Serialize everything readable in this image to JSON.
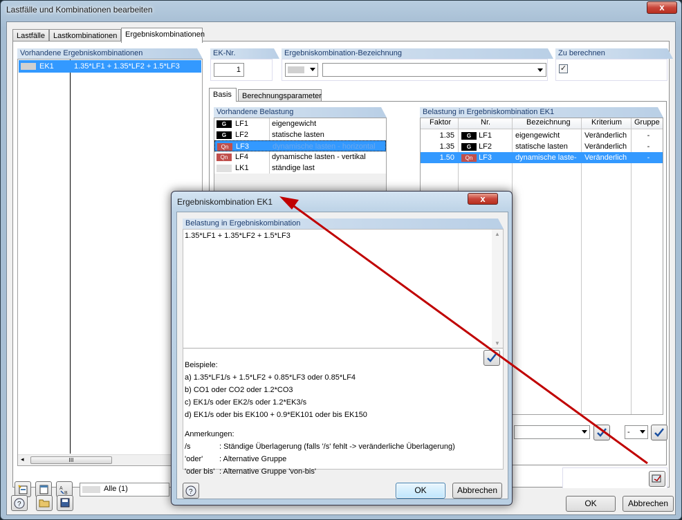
{
  "window": {
    "title": "Lastfälle und Kombinationen bearbeiten",
    "close": "x"
  },
  "tabs": [
    "Lastfälle",
    "Lastkombinationen",
    "Ergebniskombinationen"
  ],
  "left": {
    "header": "Vorhandene Ergebniskombinationen",
    "items": [
      {
        "id": "EK1",
        "formula": "1.35*LF1 + 1.35*LF2 + 1.5*LF3"
      }
    ],
    "scroll_thumb": "III",
    "filter": "Alle (1)"
  },
  "ek": {
    "label": "EK-Nr.",
    "value": "1"
  },
  "bez": {
    "label": "Ergebniskombination-Bezeichnung",
    "value": ""
  },
  "zu": {
    "label": "Zu berechnen",
    "checked": "✓"
  },
  "subtabs": [
    "Basis",
    "Berechnungsparameter"
  ],
  "vb": {
    "header": "Vorhandene Belastung",
    "rows": [
      {
        "type": "G",
        "id": "LF1",
        "name": "eigengewicht"
      },
      {
        "type": "G",
        "id": "LF2",
        "name": "statische lasten"
      },
      {
        "type": "Qn",
        "id": "LF3",
        "name": "dynamische lasten - horizontal"
      },
      {
        "type": "Qn",
        "id": "LF4",
        "name": "dynamische lasten - vertikal"
      },
      {
        "type": "",
        "id": "LK1",
        "name": "ständige last"
      }
    ]
  },
  "bek": {
    "header": "Belastung in Ergebniskombination EK1",
    "cols": [
      "Faktor",
      "Nr.",
      "Bezeichnung",
      "Kriterium",
      "Gruppe"
    ],
    "rows": [
      {
        "f": "1.35",
        "type": "G",
        "id": "LF1",
        "name": "eigengewicht",
        "k": "Veränderlich",
        "g": "-"
      },
      {
        "f": "1.35",
        "type": "G",
        "id": "LF2",
        "name": "statische lasten",
        "k": "Veränderlich",
        "g": "-"
      },
      {
        "f": "1.50",
        "type": "Qn",
        "id": "LF3",
        "name": "dynamische laste-",
        "k": "Veränderlich",
        "g": "-"
      }
    ],
    "gruppe_sel": "-"
  },
  "dialog": {
    "title": "Ergebniskombination EK1",
    "close": "x",
    "header": "Belastung in Ergebniskombination",
    "formula": "1.35*LF1 + 1.35*LF2 + 1.5*LF3",
    "beispiele_label": "Beispiele:",
    "beispiele": [
      "a)  1.35*LF1/s + 1.5*LF2 + 0.85*LF3 oder 0.85*LF4",
      "b)  CO1 oder CO2 oder 1.2*CO3",
      "c)  EK1/s oder EK2/s oder 1.2*EK3/s",
      "d)  EK1/s oder bis EK100 + 0.9*EK101 oder bis EK150"
    ],
    "anmerkungen_label": "Anmerkungen:",
    "anmerkungen": [
      {
        "k": "/s",
        "v": ": Ständige Überlagerung (falls '/s' fehlt -> veränderliche Überlagerung)"
      },
      {
        "k": "'oder'",
        "v": ": Alternative Gruppe"
      },
      {
        "k": "'oder bis'",
        "v": ": Alternative Gruppe 'von-bis'"
      }
    ],
    "ok": "OK",
    "cancel": "Abbrechen"
  },
  "footer": {
    "ok": "OK",
    "cancel": "Abbrechen"
  },
  "colors": {
    "selection": "#3399ff",
    "accent": "#1c3c6e",
    "arrow": "#c00000"
  }
}
